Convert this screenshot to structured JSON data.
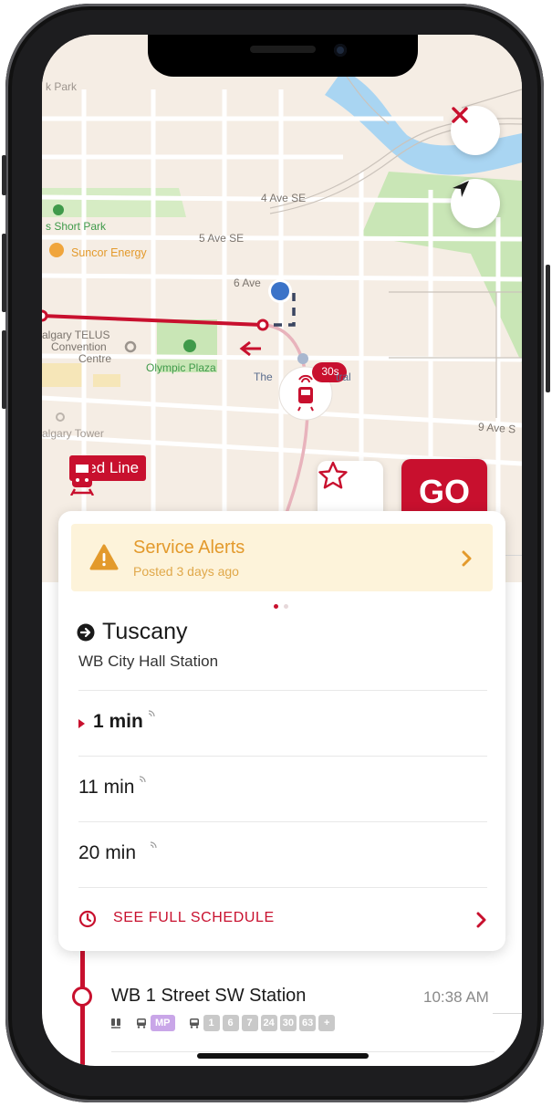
{
  "map": {
    "labels": {
      "park_top": "k Park",
      "ave4": "4 Ave SE",
      "short_park": "s Short Park",
      "ave5": "5 Ave SE",
      "suncor": "Suncor Energy",
      "ave6": "6 Ave",
      "telus": "algary TELUS",
      "convention": "Convention",
      "centre": "Centre",
      "olympic": "Olympic Plaza",
      "library_a": "The",
      "library_b": "tral",
      "tower": "algary Tower",
      "ave9": "9 Ave S"
    },
    "vehicle_eta": "30s",
    "icons": {
      "close": "close-icon",
      "locate": "location-arrow-icon",
      "train": "train-icon",
      "star": "star-outline-icon"
    },
    "colors": {
      "brand_red": "#c8102e",
      "alert_orange": "#e39a2c",
      "map_bg": "#f5ede4",
      "river": "#a9d5f2",
      "park": "#c9e6b6"
    }
  },
  "route": {
    "name": "Red Line"
  },
  "go_label": "GO",
  "alert": {
    "title": "Service Alerts",
    "subtitle": "Posted 3 days ago"
  },
  "destination": {
    "name": "Tuscany",
    "stop": "WB City Hall Station"
  },
  "arrivals": [
    {
      "time": "1 min",
      "next": true
    },
    {
      "time": "11 min",
      "next": false
    },
    {
      "time": "20 min",
      "next": false
    }
  ],
  "schedule_label": "SEE FULL SCHEDULE",
  "next_stop": {
    "name": "WB 1 Street SW Station",
    "time": "10:38 AM",
    "connections": {
      "express": "MP",
      "routes": [
        "1",
        "6",
        "7",
        "24",
        "30",
        "63",
        "+"
      ]
    }
  }
}
